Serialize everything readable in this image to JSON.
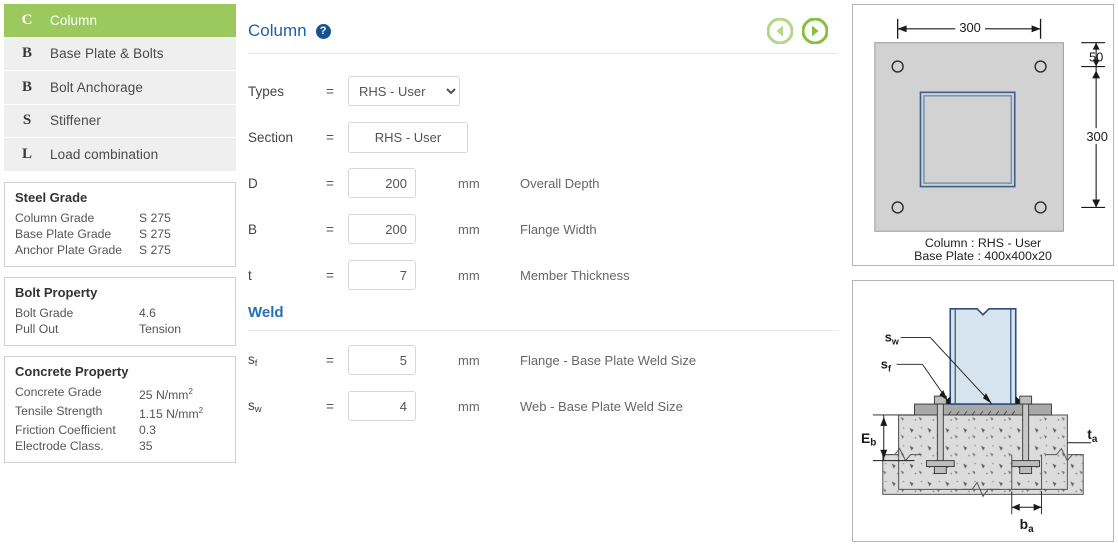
{
  "sidebar": {
    "items": [
      {
        "icon": "C",
        "label": "Column",
        "active": true
      },
      {
        "icon": "B",
        "label": "Base Plate & Bolts",
        "active": false
      },
      {
        "icon": "B",
        "label": "Bolt Anchorage",
        "active": false
      },
      {
        "icon": "S",
        "label": "Stiffener",
        "active": false
      },
      {
        "icon": "L",
        "label": "Load combination",
        "active": false
      }
    ],
    "cards": [
      {
        "title": "Steel Grade",
        "rows": [
          {
            "key": "Column Grade",
            "value": "S 275"
          },
          {
            "key": "Base Plate Grade",
            "value": "S 275"
          },
          {
            "key": "Anchor Plate Grade",
            "value": "S 275"
          }
        ]
      },
      {
        "title": "Bolt Property",
        "rows": [
          {
            "key": "Bolt Grade",
            "value": "4.6"
          },
          {
            "key": "Pull Out",
            "value": "Tension"
          }
        ]
      },
      {
        "title": "Concrete Property",
        "rows": [
          {
            "key": "Concrete Grade",
            "value": "25 N/mm",
            "sup": "2"
          },
          {
            "key": "Tensile Strength",
            "value": "1.15 N/mm",
            "sup": "2"
          },
          {
            "key": "Friction Coefficient",
            "value": "0.3"
          },
          {
            "key": "Electrode Class.",
            "value": "35"
          }
        ]
      }
    ]
  },
  "panel": {
    "title": "Column",
    "help_glyph": "?",
    "prev_label": "Previous",
    "next_label": "Next",
    "types": {
      "label": "Types",
      "eq": "=",
      "selected": "RHS - User",
      "options": [
        "RHS - User"
      ]
    },
    "section": {
      "label": "Section",
      "eq": "=",
      "value": "RHS - User"
    },
    "fields": [
      {
        "sym": "D",
        "sub": "",
        "eq": "=",
        "value": "200",
        "unit": "mm",
        "desc": "Overall Depth"
      },
      {
        "sym": "B",
        "sub": "",
        "eq": "=",
        "value": "200",
        "unit": "mm",
        "desc": "Flange Width"
      },
      {
        "sym": "t",
        "sub": "",
        "eq": "=",
        "value": "7",
        "unit": "mm",
        "desc": "Member Thickness"
      }
    ],
    "weld": {
      "heading": "Weld",
      "fields": [
        {
          "sym": "s",
          "sub": "f",
          "eq": "=",
          "value": "5",
          "unit": "mm",
          "desc": "Flange - Base Plate Weld Size"
        },
        {
          "sym": "s",
          "sub": "w",
          "eq": "=",
          "value": "4",
          "unit": "mm",
          "desc": "Web - Base Plate Weld Size"
        }
      ]
    }
  },
  "drawings": {
    "plan": {
      "dim_width": "300",
      "dim_edge": "50",
      "dim_height": "300",
      "caption_line1": "Column : RHS - User",
      "caption_line2": "Base Plate : 400x400x20"
    },
    "elevation": {
      "label_sw": "s",
      "label_sw_sub": "w",
      "label_sf": "s",
      "label_sf_sub": "f",
      "label_eb": "E",
      "label_eb_sub": "b",
      "label_ta": "t",
      "label_ta_sub": "a",
      "label_ba": "b",
      "label_ba_sub": "a"
    }
  },
  "colors": {
    "accent_green": "#9bc95e",
    "title_blue": "#1f5fa9",
    "section_blue": "#2470b8",
    "help_blue": "#15538f",
    "plate_gray": "#d2d2d2",
    "column_blue": "#4a6f9b"
  }
}
